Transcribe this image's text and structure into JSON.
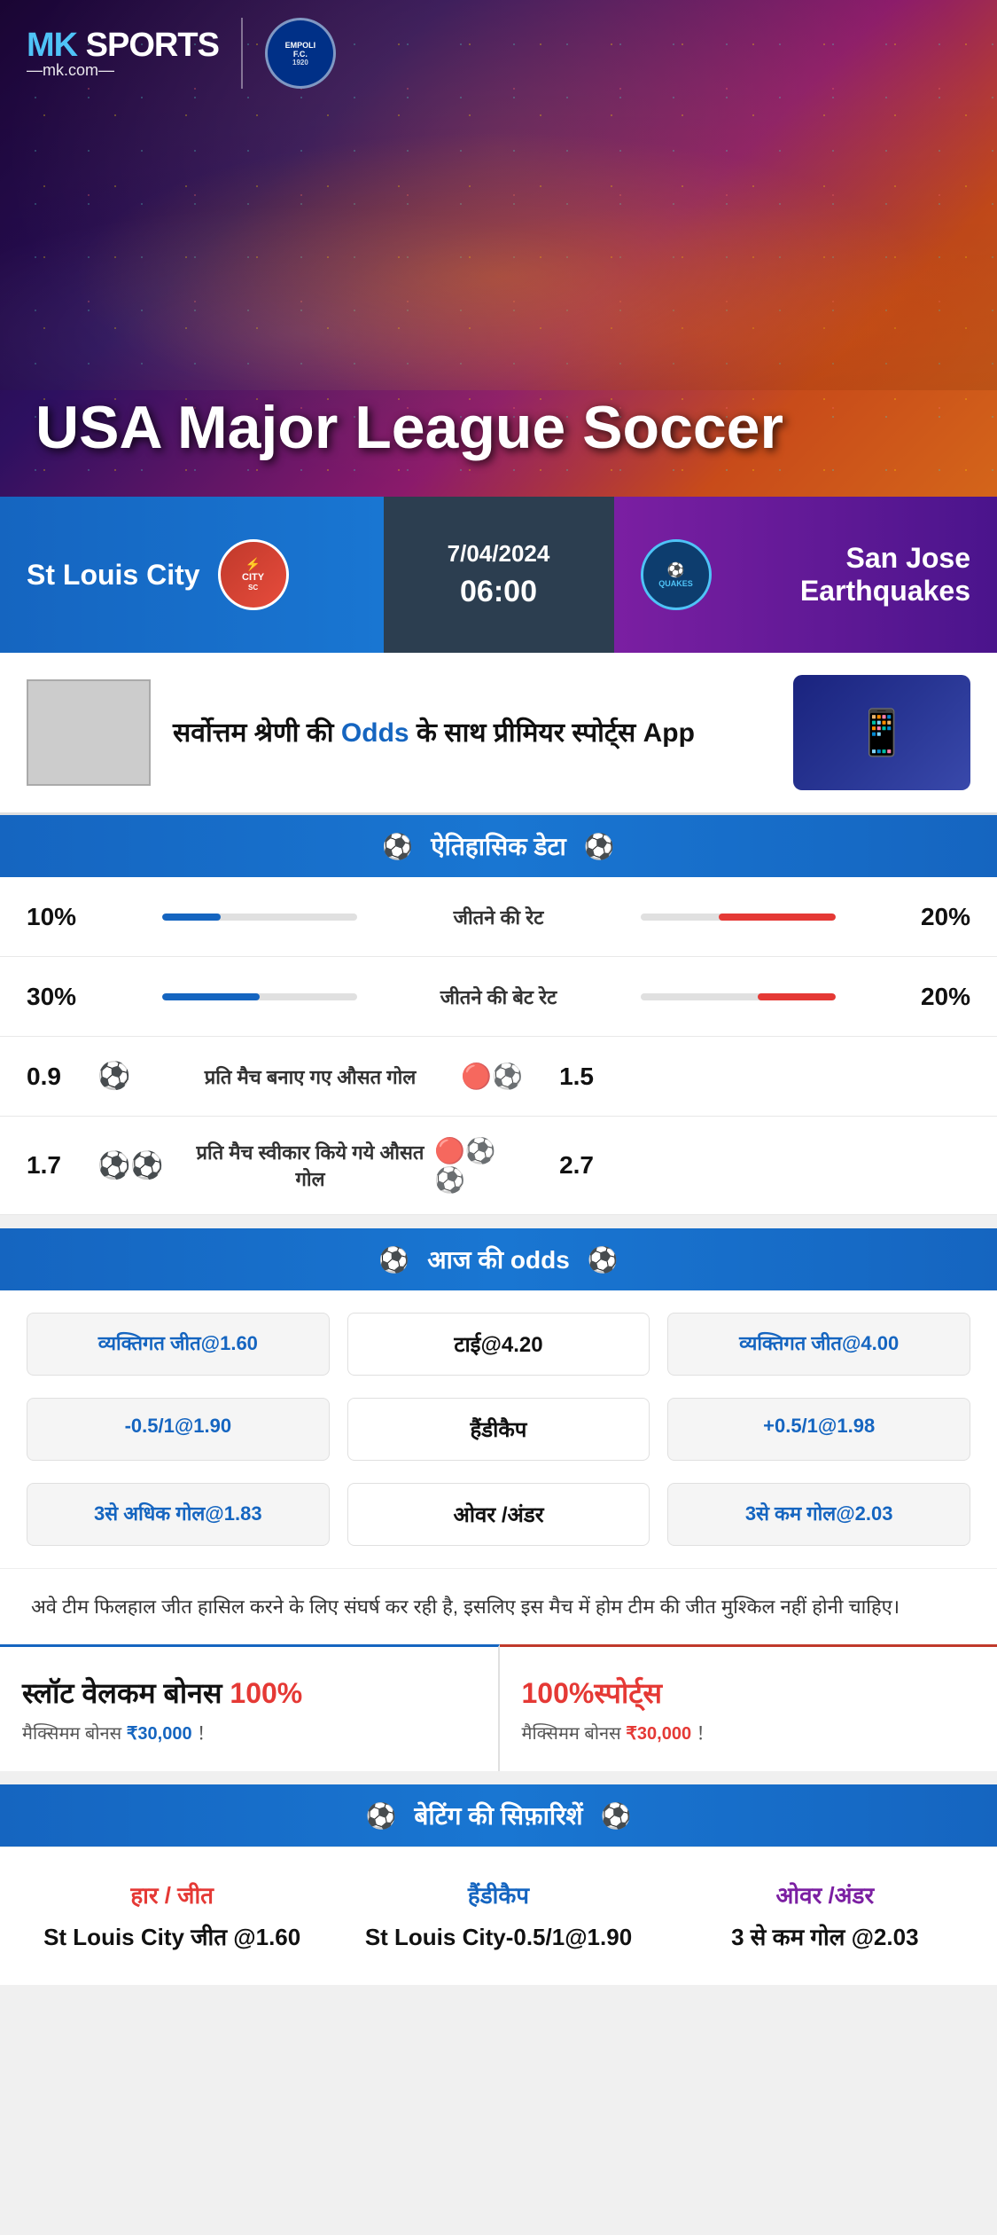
{
  "brand": {
    "name": "MK",
    "sport": "SPORTS",
    "url": "mk.com",
    "partner": "EMPOLI F.C.",
    "partner_year": "1920"
  },
  "hero": {
    "title": "USA Major League Soccer"
  },
  "match": {
    "team_home": "St Louis City",
    "team_away": "San Jose Earthquakes",
    "team_away_short": "QUAKES",
    "date": "7/04/2024",
    "time": "06:00",
    "home_logo": "STL CITY SC",
    "away_logo": "QUAKES"
  },
  "promo": {
    "text": "सर्वोत्तम श्रेणी की Odds के साथ प्रीमियर स्पोर्ट्स App",
    "highlight": "Odds"
  },
  "historical": {
    "section_title": "ऐतिहासिक डेटा",
    "stats": [
      {
        "label": "जीतने की रेट",
        "left_val": "10%",
        "right_val": "20%",
        "left_pct": 30,
        "right_pct": 60
      },
      {
        "label": "जीतने की बेट रेट",
        "left_val": "30%",
        "right_val": "20%",
        "left_pct": 50,
        "right_pct": 40
      },
      {
        "label": "प्रति मैच बनाए गए औसत गोल",
        "left_val": "0.9",
        "right_val": "1.5",
        "left_balls": 1,
        "right_balls": 2
      },
      {
        "label": "प्रति मैच स्वीकार किये गये औसत गोल",
        "left_val": "1.7",
        "right_val": "2.7",
        "left_balls": 2,
        "right_balls": 3
      }
    ]
  },
  "odds": {
    "section_title": "आज की odds",
    "row1": {
      "left": "व्यक्तिगत जीत@1.60",
      "center": "टाई@4.20",
      "right": "व्यक्तिगत जीत@4.00"
    },
    "row2": {
      "left": "-0.5/1@1.90",
      "center": "हैंडीकैप",
      "right": "+0.5/1@1.98"
    },
    "row3": {
      "left": "3से अधिक गोल@1.83",
      "center": "ओवर /अंडर",
      "right": "3से कम गोल@2.03"
    }
  },
  "notice": {
    "text": "अवे टीम फिलहाल जीत हासिल करने के लिए संघर्ष कर रही है, इसलिए इस मैच में होम टीम की जीत मुश्किल नहीं होनी चाहिए।"
  },
  "bonus": {
    "left_title": "स्लॉट वेलकम बोनस 100%",
    "left_pct": "100%",
    "left_subtitle": "मैक्सिमम बोनस ₹30,000  ！",
    "right_title": "100%स्पोर्ट्स",
    "right_pct": "100%",
    "right_subtitle": "मैक्सिमम बोनस  ₹30,000 ！"
  },
  "recommendations": {
    "section_title": "बेटिंग की सिफ़ारिशें",
    "win_label": "हार / जीत",
    "win_value": "St Louis City जीत @1.60",
    "handicap_label": "हैंडीकैप",
    "handicap_value": "St Louis City-0.5/1@1.90",
    "ou_label": "ओवर /अंडर",
    "ou_value": "3 से कम गोल @2.03"
  }
}
